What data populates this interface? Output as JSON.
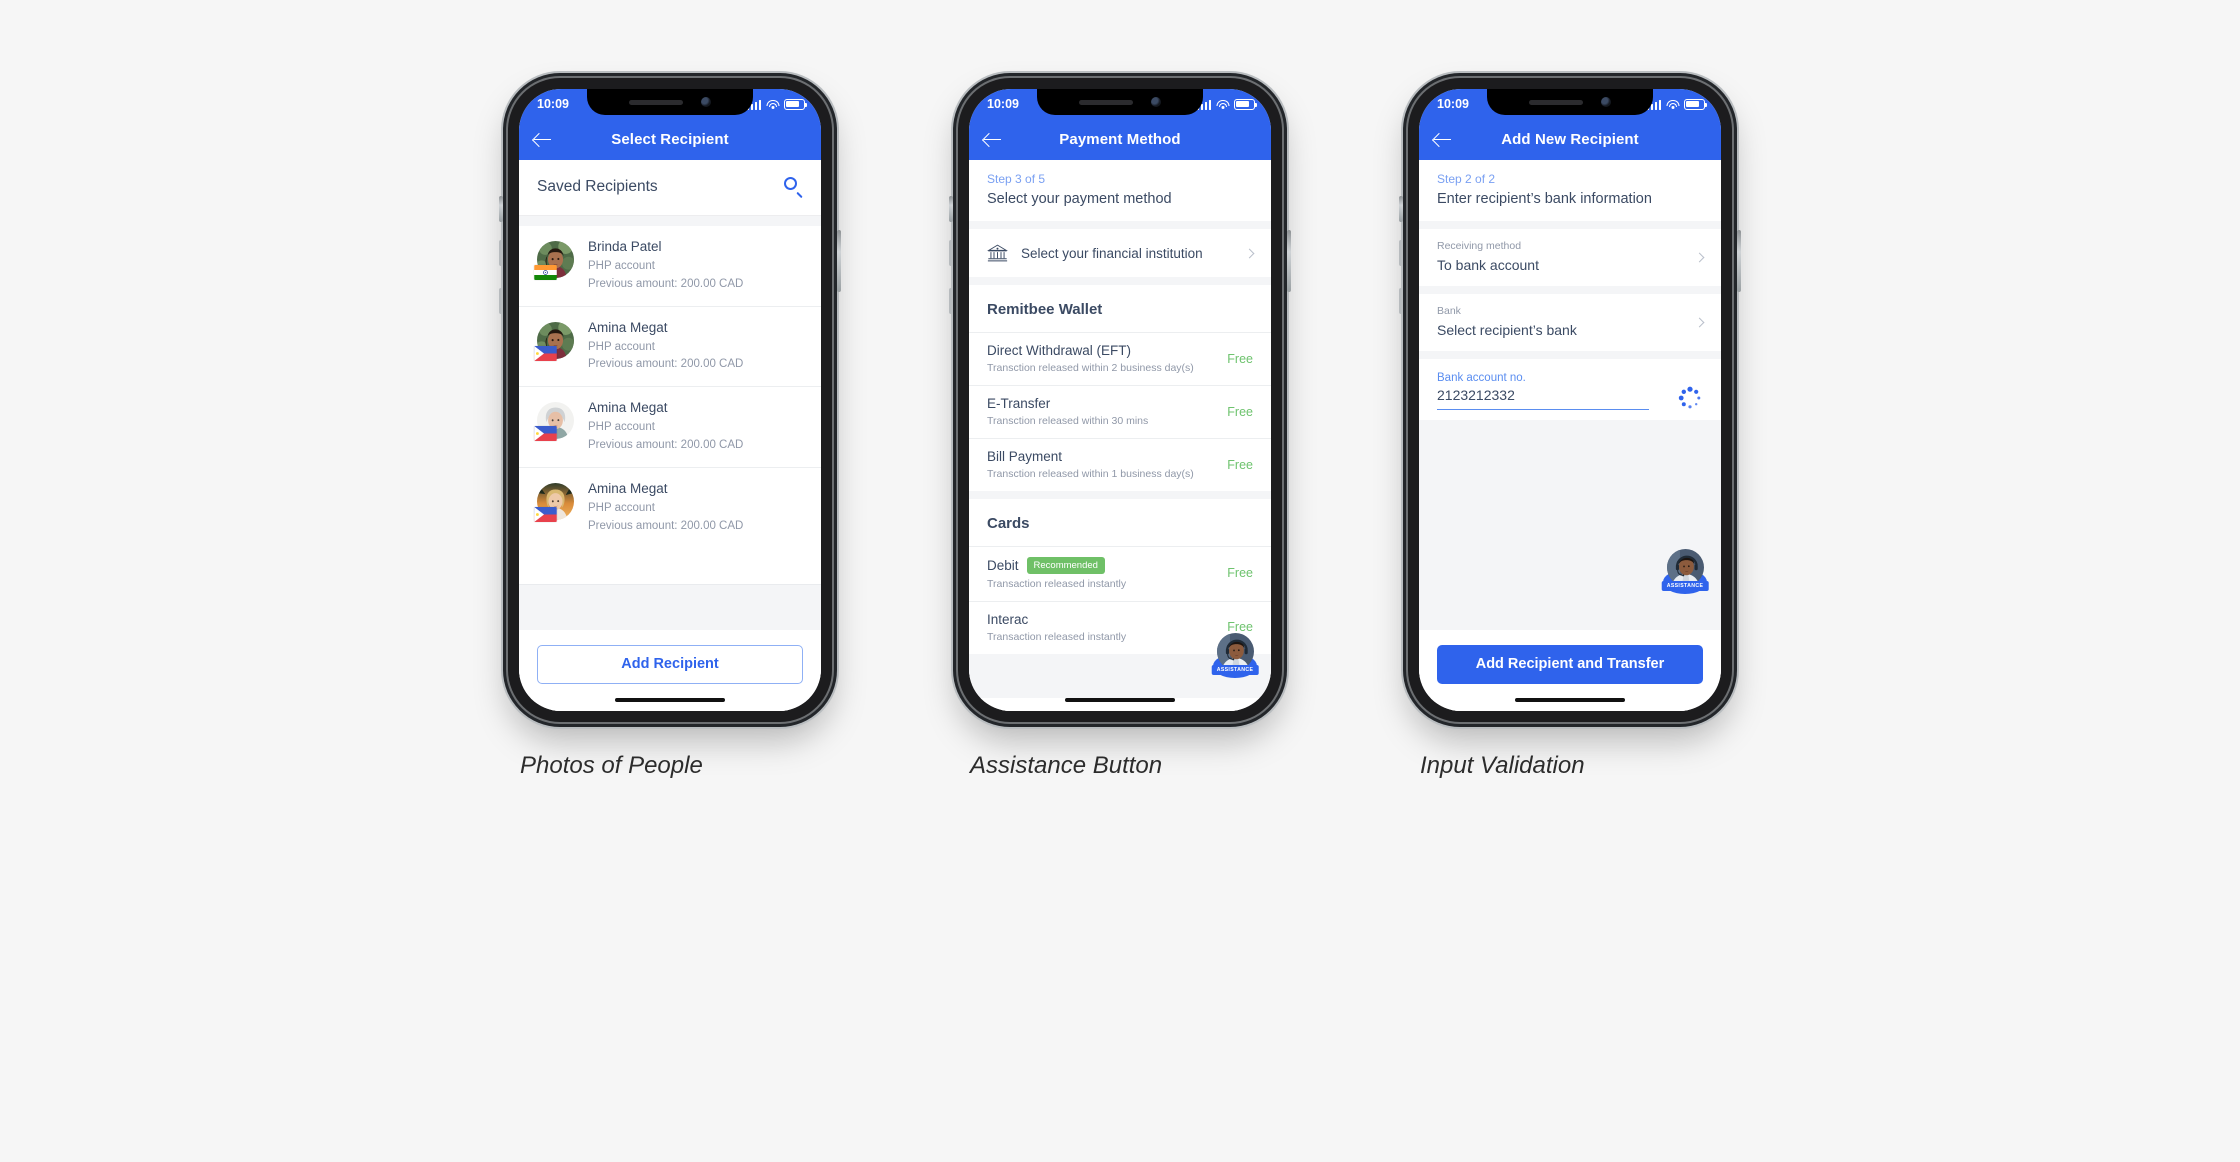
{
  "theme": {
    "brand_blue": "#2f63ec",
    "text_dark": "#3b4a63",
    "text_muted": "#9098a8",
    "free_green": "#6ec36e",
    "badge_green": "#6fc067",
    "page_bg": "#f6f6f6"
  },
  "status_bar": {
    "time": "10:09"
  },
  "screens": [
    {
      "id": "select-recipient",
      "appbar": {
        "title": "Select Recipient",
        "back_icon": "back-arrow-icon"
      },
      "section": {
        "title": "Saved Recipients",
        "search_icon": "search-icon"
      },
      "recipients": [
        {
          "name": "Brinda Patel",
          "account": "PHP account",
          "previous": "Previous amount: 200.00 CAD",
          "flag": "in",
          "avatar": "woman-indian-green"
        },
        {
          "name": "Amina Megat",
          "account": "PHP account",
          "previous": "Previous amount: 200.00 CAD",
          "flag": "ph",
          "avatar": "woman-indian-green"
        },
        {
          "name": "Amina Megat",
          "account": "PHP account",
          "previous": "Previous amount: 200.00 CAD",
          "flag": "ph",
          "avatar": "woman-senior-grey"
        },
        {
          "name": "Amina Megat",
          "account": "PHP account",
          "previous": "Previous amount: 200.00 CAD",
          "flag": "ph",
          "avatar": "woman-blonde-sunset"
        }
      ],
      "primary_button": "Add Recipient",
      "caption": "Photos of People"
    },
    {
      "id": "payment-method",
      "appbar": {
        "title": "Payment Method",
        "back_icon": "back-arrow-icon"
      },
      "step": {
        "label": "Step 3 of 5",
        "title": "Select your payment method"
      },
      "institution_row": {
        "label": "Select your financial institution",
        "icon": "bank-icon",
        "chevron": "chevron-right-icon"
      },
      "groups": [
        {
          "title": "Remitbee Wallet",
          "options": [
            {
              "name": "Direct Withdrawal (EFT)",
              "desc": "Transction released within 2 business day(s)",
              "fee": "Free",
              "badge": null
            },
            {
              "name": "E-Transfer",
              "desc": "Transction released within 30 mins",
              "fee": "Free",
              "badge": null
            },
            {
              "name": "Bill Payment",
              "desc": "Transction released within 1 business day(s)",
              "fee": "Free",
              "badge": null
            }
          ]
        },
        {
          "title": "Cards",
          "options": [
            {
              "name": "Debit",
              "desc": "Transaction released instantly",
              "fee": "Free",
              "badge": "Recommended"
            },
            {
              "name": "Interac",
              "desc": "Transaction released instantly",
              "fee": "Free",
              "badge": null
            }
          ]
        }
      ],
      "assistance": {
        "label": "ASSISTANCE",
        "icon": "support-agent-avatar"
      },
      "caption": "Assistance Button"
    },
    {
      "id": "add-new-recipient",
      "appbar": {
        "title": "Add New Recipient",
        "back_icon": "back-arrow-icon"
      },
      "step": {
        "label": "Step 2 of 2",
        "title": "Enter recipient’s bank information"
      },
      "fields": [
        {
          "label": "Receiving method",
          "value": "To bank account",
          "chevron": "chevron-right-icon"
        },
        {
          "label": "Bank",
          "value": "Select recipient’s bank",
          "chevron": "chevron-right-icon"
        }
      ],
      "account_input": {
        "label": "Bank account no.",
        "value": "2123212332",
        "spinner_icon": "loading-spinner-icon"
      },
      "assistance": {
        "label": "ASSISTANCE",
        "icon": "support-agent-avatar"
      },
      "primary_button": "Add Recipient and Transfer",
      "caption": "Input Validation"
    }
  ]
}
